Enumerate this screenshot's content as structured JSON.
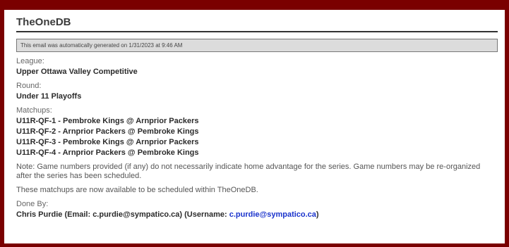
{
  "header": {
    "brand": "TheOneDB",
    "generated_notice": "This email was automatically generated on 1/31/2023 at 9:46 AM"
  },
  "fields": {
    "league_label": "League:",
    "league_value": "Upper Ottawa Valley Competitive",
    "round_label": "Round:",
    "round_value": "Under 11 Playoffs",
    "matchups_label": "Matchups:",
    "matchups": [
      "U11R-QF-1 - Pembroke Kings @ Arnprior Packers",
      "U11R-QF-2 - Arnprior Packers @ Pembroke Kings",
      "U11R-QF-3 - Pembroke Kings @ Arnprior Packers",
      "U11R-QF-4 - Arnprior Packers @ Pembroke Kings"
    ]
  },
  "notes": {
    "game_numbers": "Note: Game numbers provided (if any) do not necessarily indicate home advantage for the series. Game numbers may be re-organized after the series has been scheduled.",
    "available": "These matchups are now available to be scheduled within TheOneDB."
  },
  "done_by": {
    "label": "Done By:",
    "prefix": "Chris Purdie (Email: c.purdie@sympatico.ca) (Username: ",
    "username": "c.purdie@sympatico.ca",
    "suffix": ")"
  },
  "colors": {
    "frame_border": "#7a0000",
    "link": "#1a33cc",
    "notice_bg": "#dcdcdc"
  }
}
